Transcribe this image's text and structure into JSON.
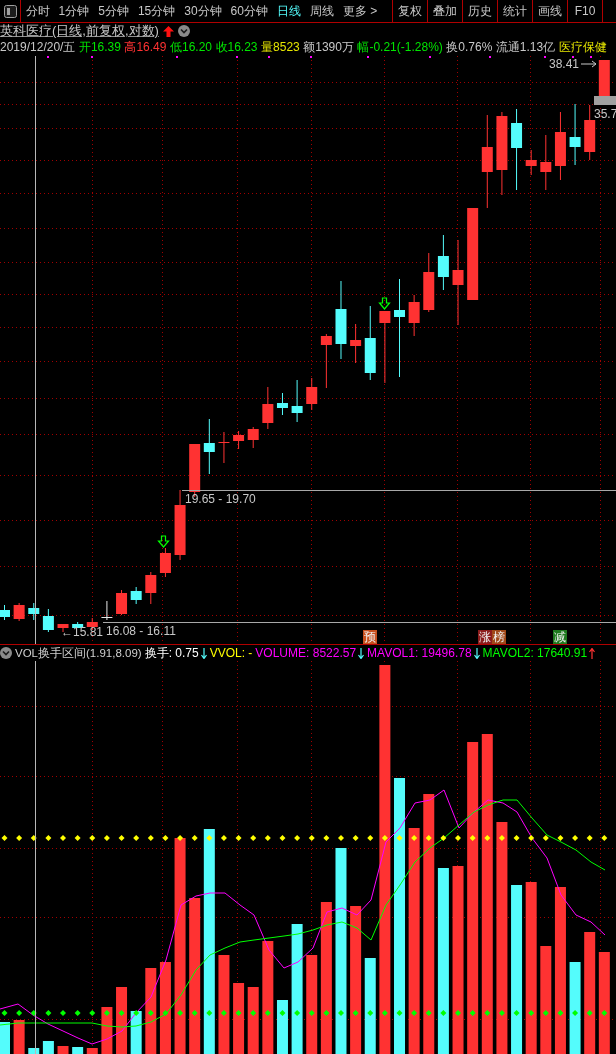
{
  "toolbar": {
    "periods": [
      {
        "label": "分时",
        "selected": false
      },
      {
        "label": "1分钟",
        "selected": false
      },
      {
        "label": "5分钟",
        "selected": false
      },
      {
        "label": "15分钟",
        "selected": false
      },
      {
        "label": "30分钟",
        "selected": false
      },
      {
        "label": "60分钟",
        "selected": false
      },
      {
        "label": "日线",
        "selected": true
      },
      {
        "label": "周线",
        "selected": false
      },
      {
        "label": "更多 >",
        "selected": false
      }
    ],
    "tools": [
      "复权",
      "叠加",
      "历史",
      "统计",
      "画线",
      "F10"
    ]
  },
  "chart_title": {
    "text": "英科医疗(日线,前复权,对数)"
  },
  "quote": [
    {
      "kind": "date",
      "text": "2019/12/20/五"
    },
    {
      "kind": "price",
      "text": "开16.39",
      "rising": false
    },
    {
      "kind": "price",
      "text": "高16.49",
      "rising": true
    },
    {
      "kind": "price",
      "text": "低16.20",
      "rising": false
    },
    {
      "kind": "price",
      "text": "收16.23",
      "rising": false
    },
    {
      "kind": "volume",
      "text": "量8523"
    },
    {
      "kind": "stat",
      "text": "额1390万"
    },
    {
      "kind": "price",
      "text": "幅-0.21(-1.28%)",
      "rising": false
    },
    {
      "kind": "stat",
      "text": "换0.76%"
    },
    {
      "kind": "stat",
      "text": "流通1.13亿"
    },
    {
      "kind": "sector",
      "text": "医疗保健"
    }
  ],
  "price_chart": {
    "labels": [
      {
        "kind": "high",
        "text": "38.41"
      },
      {
        "kind": "last",
        "text": "35.7"
      },
      {
        "kind": "range",
        "text": "19.65 - 19.70"
      },
      {
        "kind": "range",
        "text": "16.08 - 16.11"
      },
      {
        "kind": "low",
        "text": "←15.81"
      }
    ],
    "events": [
      {
        "label": "预",
        "color": "#c8501e"
      },
      {
        "label": "涨",
        "color": "#8c1c1c"
      },
      {
        "label": "榜",
        "color": "#a04818"
      },
      {
        "label": "减",
        "color": "#1e7a1e"
      }
    ]
  },
  "volume_panel": {
    "indicator": "VOL换手区间(1.91,8.09)",
    "readings": [
      {
        "text": "换手: 0.75",
        "color": "#ffffff",
        "down_arrow": true,
        "up_arrow": false
      },
      {
        "text": "VVOL: -",
        "color": "#ffff00",
        "down_arrow": false,
        "up_arrow": false
      },
      {
        "text": "VOLUME: 8522.57",
        "color": "#ff00ff",
        "down_arrow": true,
        "up_arrow": false
      },
      {
        "text": "MAVOL1: 19496.78",
        "color": "#ff00ff",
        "down_arrow": true,
        "up_arrow": false
      },
      {
        "text": "MAVOL2: 17640.91",
        "color": "#00ff00",
        "down_arrow": false,
        "up_arrow": true
      }
    ]
  }
}
